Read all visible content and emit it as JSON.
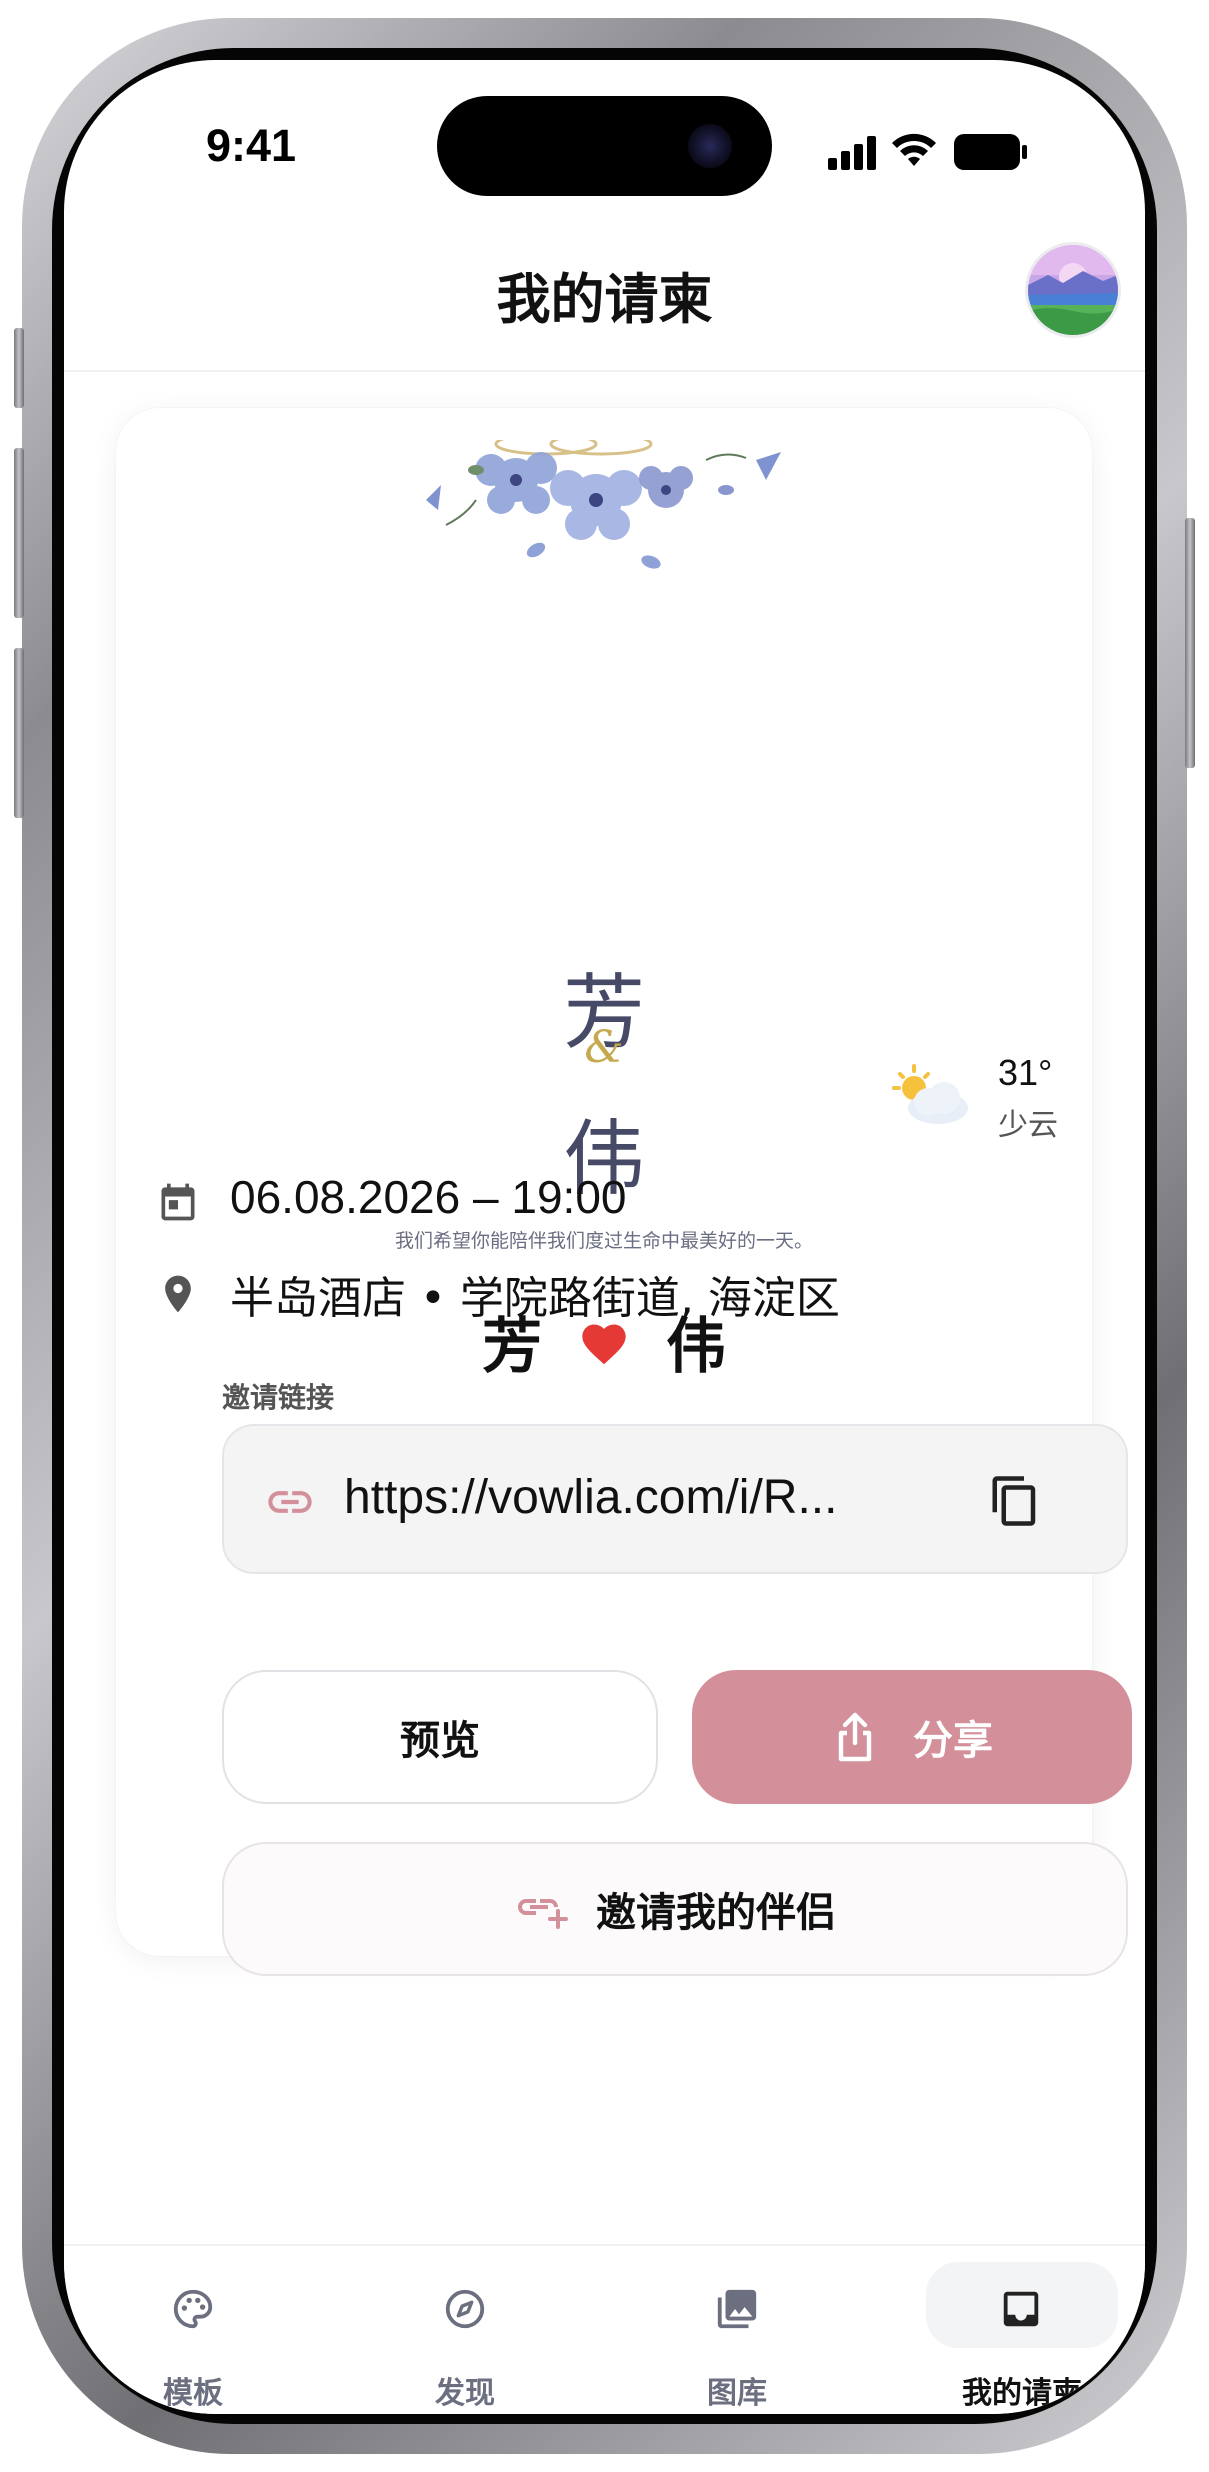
{
  "status_bar": {
    "time": "9:41"
  },
  "header": {
    "title": "我的请柬"
  },
  "invitation": {
    "name_one": "芳",
    "ampersand": "&",
    "name_two": "伟",
    "tagline": "我们希望你能陪伴我们度过生命中最美好的一天。",
    "couple_left": "芳",
    "couple_right": "伟",
    "weather": {
      "temp": "31°",
      "desc": "少云"
    },
    "datetime": "06.08.2026 – 19:00",
    "location": "半岛酒店 • 学院路街道, 海淀区",
    "link_label": "邀请链接",
    "link_url": "https://vowlia.com/i/R..."
  },
  "actions": {
    "preview": "预览",
    "share": "分享",
    "invite_partner": "邀请我的伴侣"
  },
  "bottom_nav": {
    "items": [
      {
        "label": "模板",
        "icon": "palette-icon"
      },
      {
        "label": "发现",
        "icon": "compass-icon"
      },
      {
        "label": "图库",
        "icon": "gallery-icon"
      },
      {
        "label": "我的请柬",
        "icon": "inbox-icon",
        "active": true
      }
    ]
  },
  "colors": {
    "accent": "#d4909a",
    "heart": "#e53935",
    "names": "#464a66",
    "gold": "#c6a94f"
  }
}
